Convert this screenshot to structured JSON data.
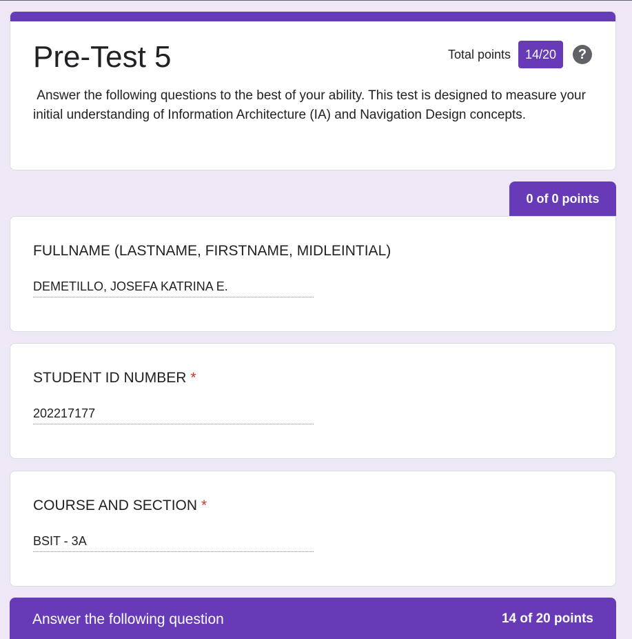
{
  "form": {
    "title": "Pre-Test 5",
    "total_points_label": "Total points",
    "total_points_value": "14/20",
    "help_icon": "help-circle-icon",
    "description": " Answer the following questions to the best of your ability. This test is designed to measure your initial understanding of Information Architecture (IA) and Navigation Design concepts."
  },
  "section1": {
    "points": "0 of 0 points",
    "questions": [
      {
        "title": "FULLNAME (LASTNAME, FIRSTNAME, MIDLEINTIAL)",
        "required": "",
        "answer": "DEMETILLO, JOSEFA KATRINA E."
      },
      {
        "title": "STUDENT ID NUMBER",
        "required": "*",
        "answer": "202217177"
      },
      {
        "title": "COURSE AND SECTION",
        "required": "*",
        "answer": "BSIT - 3A"
      }
    ]
  },
  "section2": {
    "title": "Answer the following question",
    "points": "14 of 20 points"
  },
  "colors": {
    "accent": "#673ab7",
    "background": "#ede7f6",
    "required": "#d93025"
  }
}
